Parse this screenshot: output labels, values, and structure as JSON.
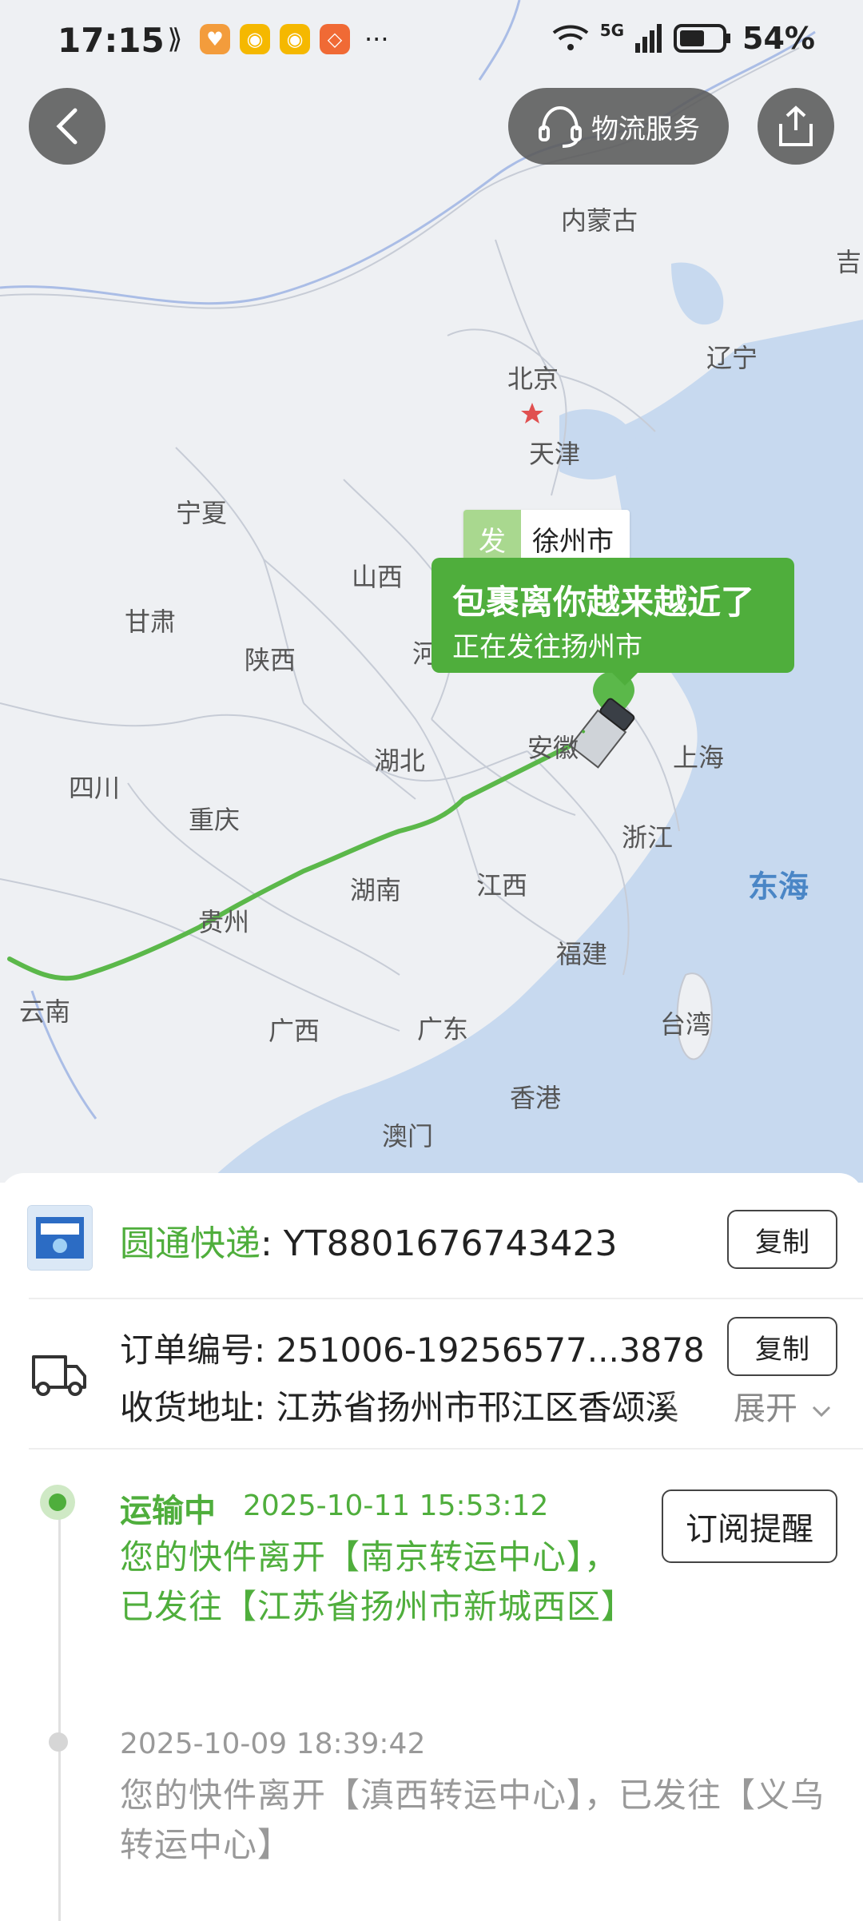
{
  "status_bar": {
    "time": "17:15",
    "more": "···",
    "network": "5G",
    "battery": "54%"
  },
  "header": {
    "service_label": "物流服务"
  },
  "map": {
    "labels": {
      "neimenggu": "内蒙古",
      "ji": "吉",
      "liaoning": "辽宁",
      "beijing": "北京",
      "tianjin": "天津",
      "ningxia": "宁夏",
      "shanxi": "山西",
      "gansu": "甘肃",
      "shaanxi": "陕西",
      "he": "河",
      "hubei": "湖北",
      "anhui": "安徽",
      "shanghai": "上海",
      "sichuan": "四川",
      "chongqing": "重庆",
      "zhejiang": "浙江",
      "hunan": "湖南",
      "jiangxi": "江西",
      "guizhou": "贵州",
      "fujian": "福建",
      "yunnan": "云南",
      "guangxi": "广西",
      "guangdong": "广东",
      "taiwan": "台湾",
      "xianggang": "香港",
      "aomen": "澳门",
      "donghai": "东海"
    },
    "origin_tag": {
      "prefix": "发",
      "city": "徐州市"
    },
    "bubble": {
      "title": "包裹离你越来越近了",
      "subtitle": "正在发往扬州市"
    }
  },
  "shipment": {
    "carrier": "圆通快递",
    "tracking_number": ": YT8801676743423",
    "copy_label": "复制",
    "order_line": "订单编号: 251006-19256577...3878",
    "address_line": "收货地址: 江苏省扬州市邗江区香颂溪",
    "expand_label": "展开",
    "subscribe_label": "订阅提醒"
  },
  "timeline": [
    {
      "status": "运输中",
      "time": "2025-10-11 15:53:12",
      "text": "您的快件离开【南京转运中心】，已发往【江苏省扬州市新城西区】"
    },
    {
      "status": "",
      "time": "2025-10-09 18:39:42",
      "text": "您的快件离开【滇西转运中心】，已发往【义乌转运中心】"
    }
  ],
  "colors": {
    "accent_green": "#4fae3c",
    "map_sea": "#c7d9ef",
    "map_land": "#eef0f3"
  }
}
